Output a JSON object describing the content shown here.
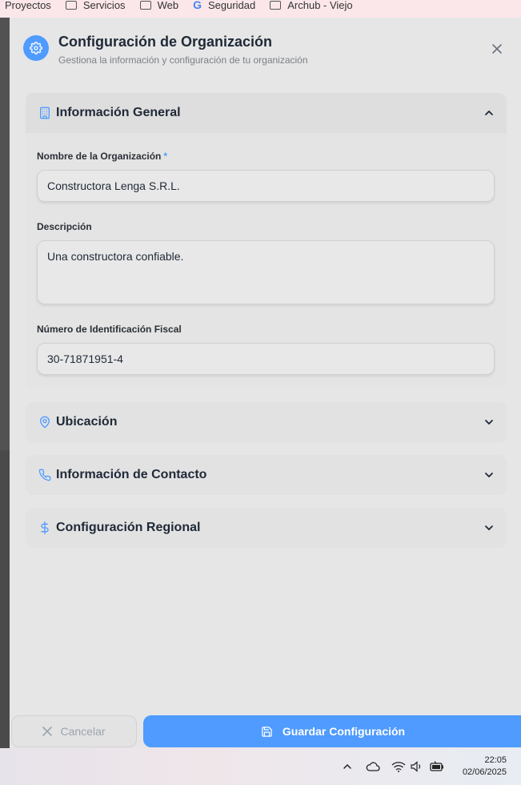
{
  "bookmarks": [
    "Proyectos",
    "Servicios",
    "Web",
    "Seguridad",
    "Archub - Viejo"
  ],
  "dialog": {
    "title": "Configuración de Organización",
    "subtitle": "Gestiona la información y configuración de tu organización",
    "icon": "gear-icon"
  },
  "sections": {
    "general": {
      "title": "Información General",
      "icon": "building-icon",
      "fields": {
        "name": {
          "label": "Nombre de la Organización",
          "required_mark": "*",
          "value": "Constructora Lenga S.R.L."
        },
        "description": {
          "label": "Descripción",
          "value": "Una constructora confiable."
        },
        "tax_id": {
          "label": "Número de Identificación Fiscal",
          "value": "30-71871951-4"
        }
      }
    },
    "location": {
      "title": "Ubicación",
      "icon": "map-pin-icon"
    },
    "contact": {
      "title": "Información de Contacto",
      "icon": "phone-icon"
    },
    "regional": {
      "title": "Configuración Regional",
      "icon": "dollar-icon"
    }
  },
  "footer": {
    "cancel_label": "Cancelar",
    "save_label": "Guardar Configuración"
  },
  "taskbar": {
    "time": "22:05",
    "date": "02/06/2025"
  },
  "colors": {
    "accent": "#4f9bff",
    "panel_bg": "#e6e6e6"
  }
}
